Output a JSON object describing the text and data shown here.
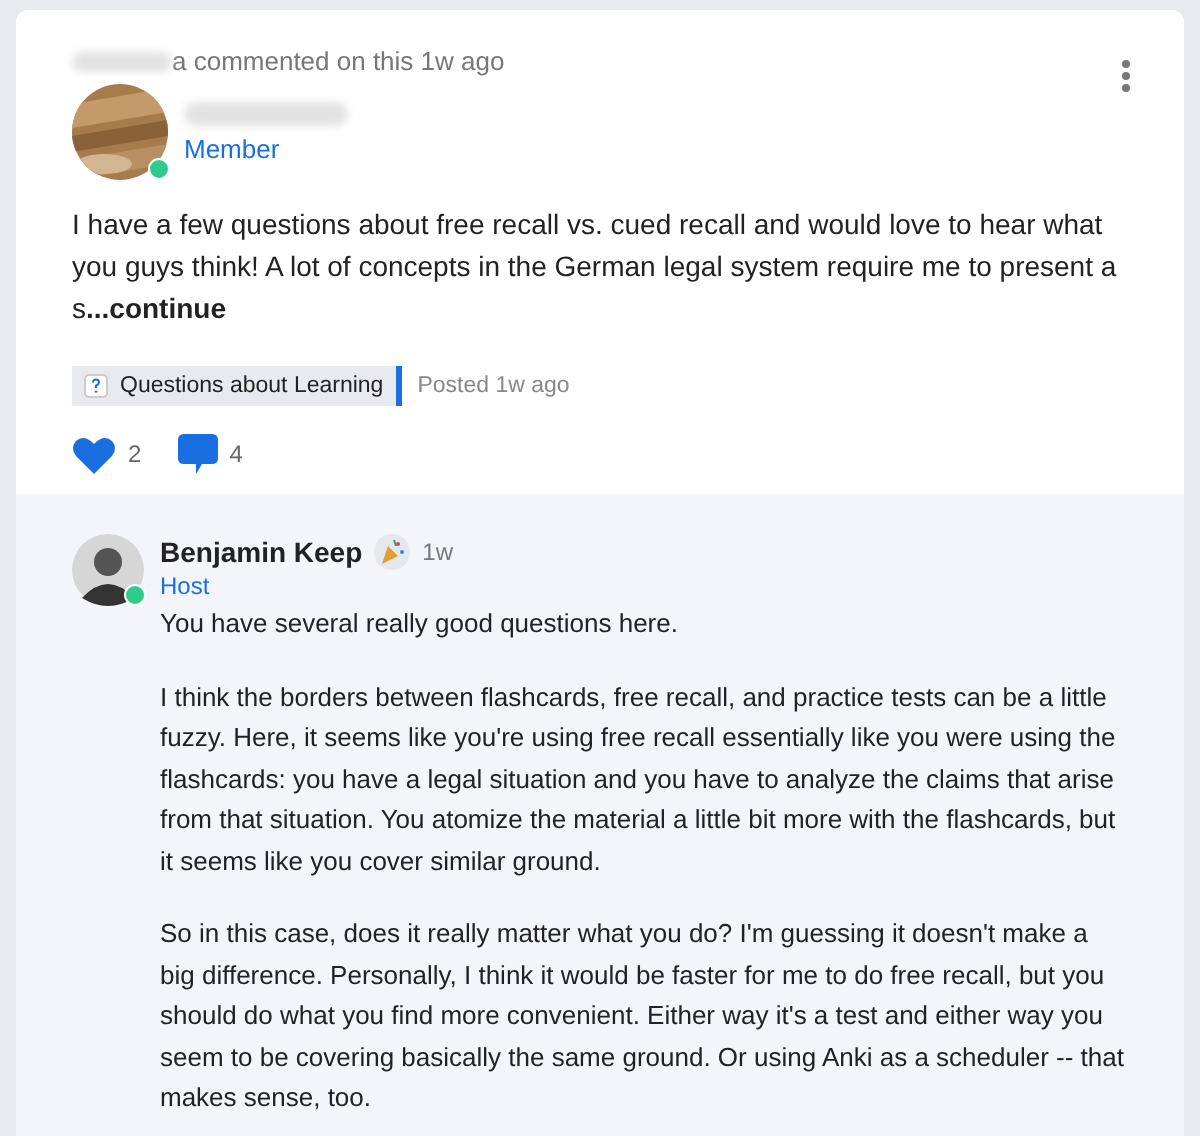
{
  "post": {
    "activity": "a commented on this 1w ago",
    "author_role": "Member",
    "online": true,
    "body": "I have a few questions about free recall vs. cued recall and would love to hear what you guys think! A lot of concepts in the German legal system require me to present a s",
    "more_link": "...continue",
    "tag": "Questions about Learning",
    "posted": "Posted 1w ago",
    "likes": "2",
    "comments": "4"
  },
  "reply": {
    "author": "Benjamin Keep",
    "time": "1w",
    "role": "Host",
    "online": true,
    "paragraphs": [
      "You have several really good questions here.",
      "I think the borders between flashcards, free recall, and practice tests can be a little fuzzy. Here, it seems like you're using free recall essentially like you were using the flashcards: you have a legal situation and you have to analyze the claims that arise from that situation. You atomize the material a little bit more with the flashcards, but it seems like you cover similar ground.",
      "So in this case, does it really matter what you do? I'm guessing it doesn't make a big difference. Personally, I think it would be faster for me to do free recall, but you should do what you find more convenient. Either way it's a test and either way you seem to be covering basically the same ground. Or using Anki as a scheduler -- that makes sense, too."
    ]
  }
}
